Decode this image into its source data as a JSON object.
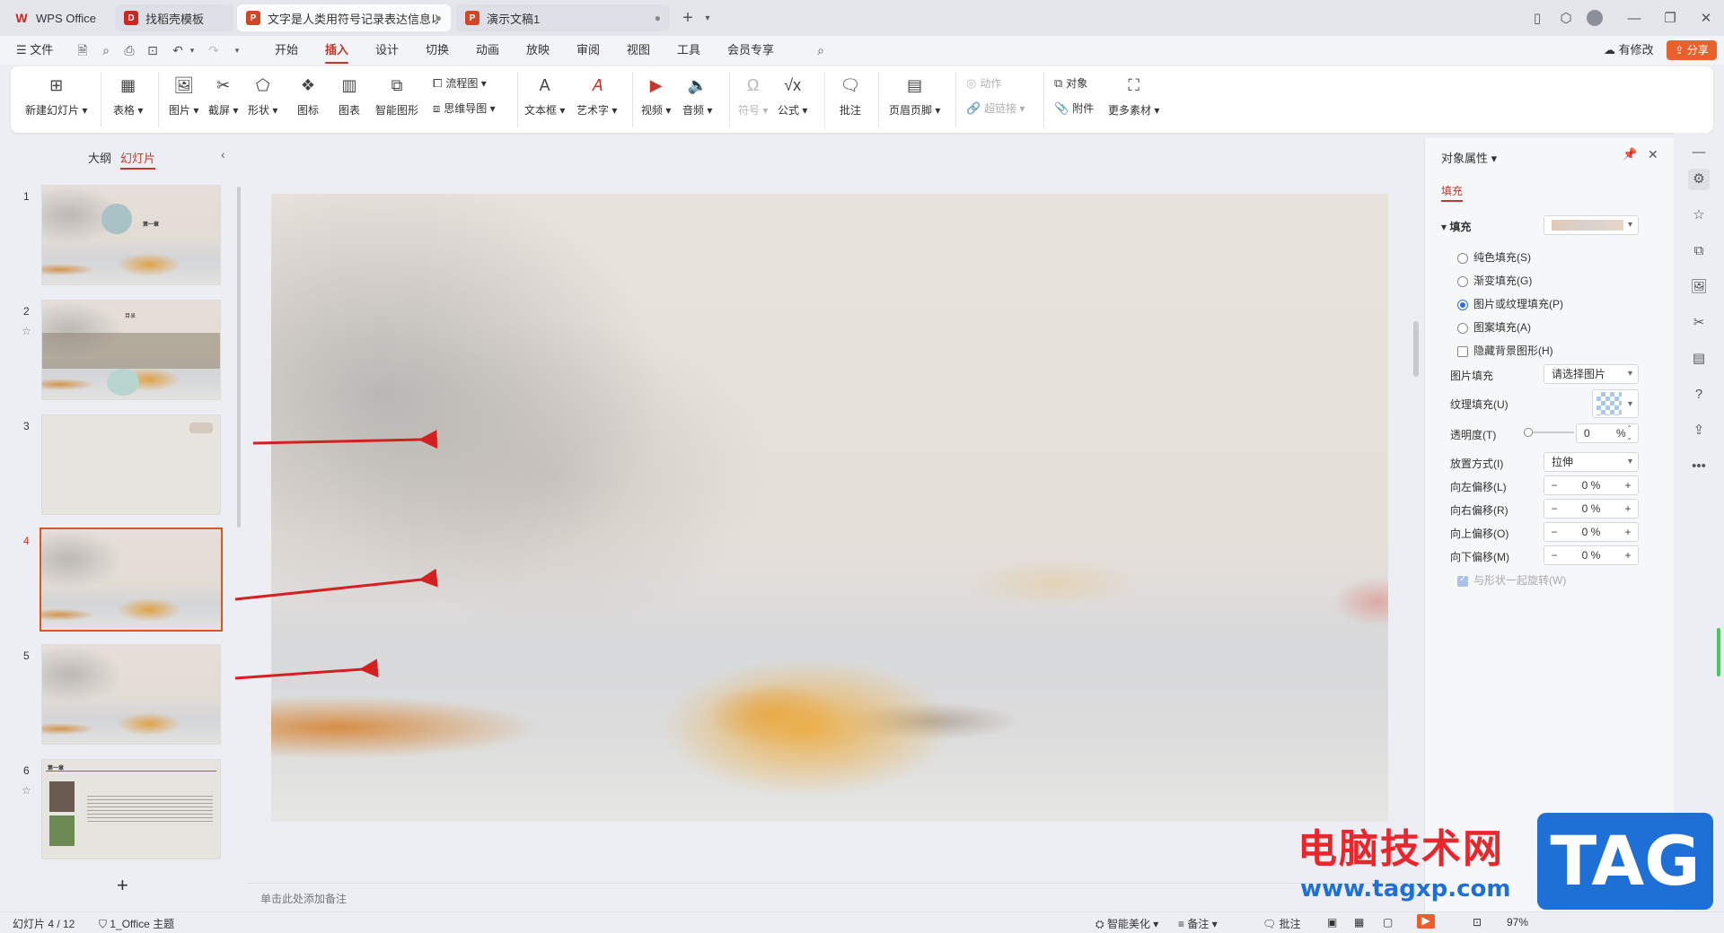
{
  "titlebar": {
    "tabs": [
      {
        "label": "WPS Office",
        "icon": "wps-logo-icon",
        "color": "#d0251f"
      },
      {
        "label": "找稻壳模板",
        "icon": "daoke-icon",
        "color": "#d0251f"
      },
      {
        "label": "文字是人类用符号记录表达信息以",
        "icon": "ppt-icon",
        "color": "#d24625"
      },
      {
        "label": "演示文稿1",
        "icon": "ppt-icon",
        "color": "#d24625"
      }
    ],
    "new_tab": "+"
  },
  "menubar": {
    "file": "文件",
    "tabs": [
      "开始",
      "插入",
      "设计",
      "切换",
      "动画",
      "放映",
      "审阅",
      "视图",
      "工具",
      "会员专享"
    ],
    "active_tab": "插入",
    "changes": "有修改",
    "share": "分享"
  },
  "ribbon": {
    "new_slide": "新建幻灯片",
    "table": "表格",
    "picture": "图片",
    "screenshot": "截屏",
    "shape": "形状",
    "icons": "图标",
    "chart": "图表",
    "smartart": "智能图形",
    "flowchart": "流程图",
    "mindmap": "思维导图",
    "textbox": "文本框",
    "wordart": "艺术字",
    "video": "视频",
    "audio": "音频",
    "symbol": "符号",
    "formula": "公式",
    "comment": "批注",
    "header_footer": "页眉页脚",
    "action": "动作",
    "hyperlink": "超链接",
    "object": "对象",
    "attachment": "附件",
    "more_material": "更多素材"
  },
  "leftpanel": {
    "tab_outline": "大纲",
    "tab_slides": "幻灯片",
    "slides": [
      {
        "num": "1",
        "title": "第一章"
      },
      {
        "num": "2",
        "title": "目录"
      },
      {
        "num": "3"
      },
      {
        "num": "4"
      },
      {
        "num": "5"
      },
      {
        "num": "6",
        "title": "第一章"
      }
    ],
    "selected": "4",
    "add": "+"
  },
  "notes": {
    "placeholder": "单击此处添加备注"
  },
  "rightpanel": {
    "title": "对象属性",
    "tab": "填充",
    "section": "填充",
    "options": {
      "solid": "纯色填充(S)",
      "gradient": "渐变填充(G)",
      "picture": "图片或纹理填充(P)",
      "pattern": "图案填充(A)",
      "hide_bg": "隐藏背景图形(H)"
    },
    "picture_fill_label": "图片填充",
    "picture_fill_value": "请选择图片",
    "texture_fill_label": "纹理填充(U)",
    "transparency_label": "透明度(T)",
    "transparency_value": "0",
    "transparency_unit": "%",
    "placement_label": "放置方式(I)",
    "placement_value": "拉伸",
    "offset_left_label": "向左偏移(L)",
    "offset_right_label": "向右偏移(R)",
    "offset_up_label": "向上偏移(O)",
    "offset_down_label": "向下偏移(M)",
    "offset_value": "0 %",
    "rotate_with_shape": "与形状一起旋转(W)"
  },
  "statusbar": {
    "slide_counter": "幻灯片 4 / 12",
    "theme": "1_Office 主题",
    "beautify": "智能美化",
    "notes": "备注",
    "comments": "批注",
    "zoom": "97%"
  },
  "watermark": {
    "site_name": "电脑技术网",
    "url": "www.tagxp.com",
    "tag": "TAG"
  },
  "colors": {
    "accent": "#c0392b",
    "selection": "#d9561d",
    "arrow": "#d42020"
  }
}
